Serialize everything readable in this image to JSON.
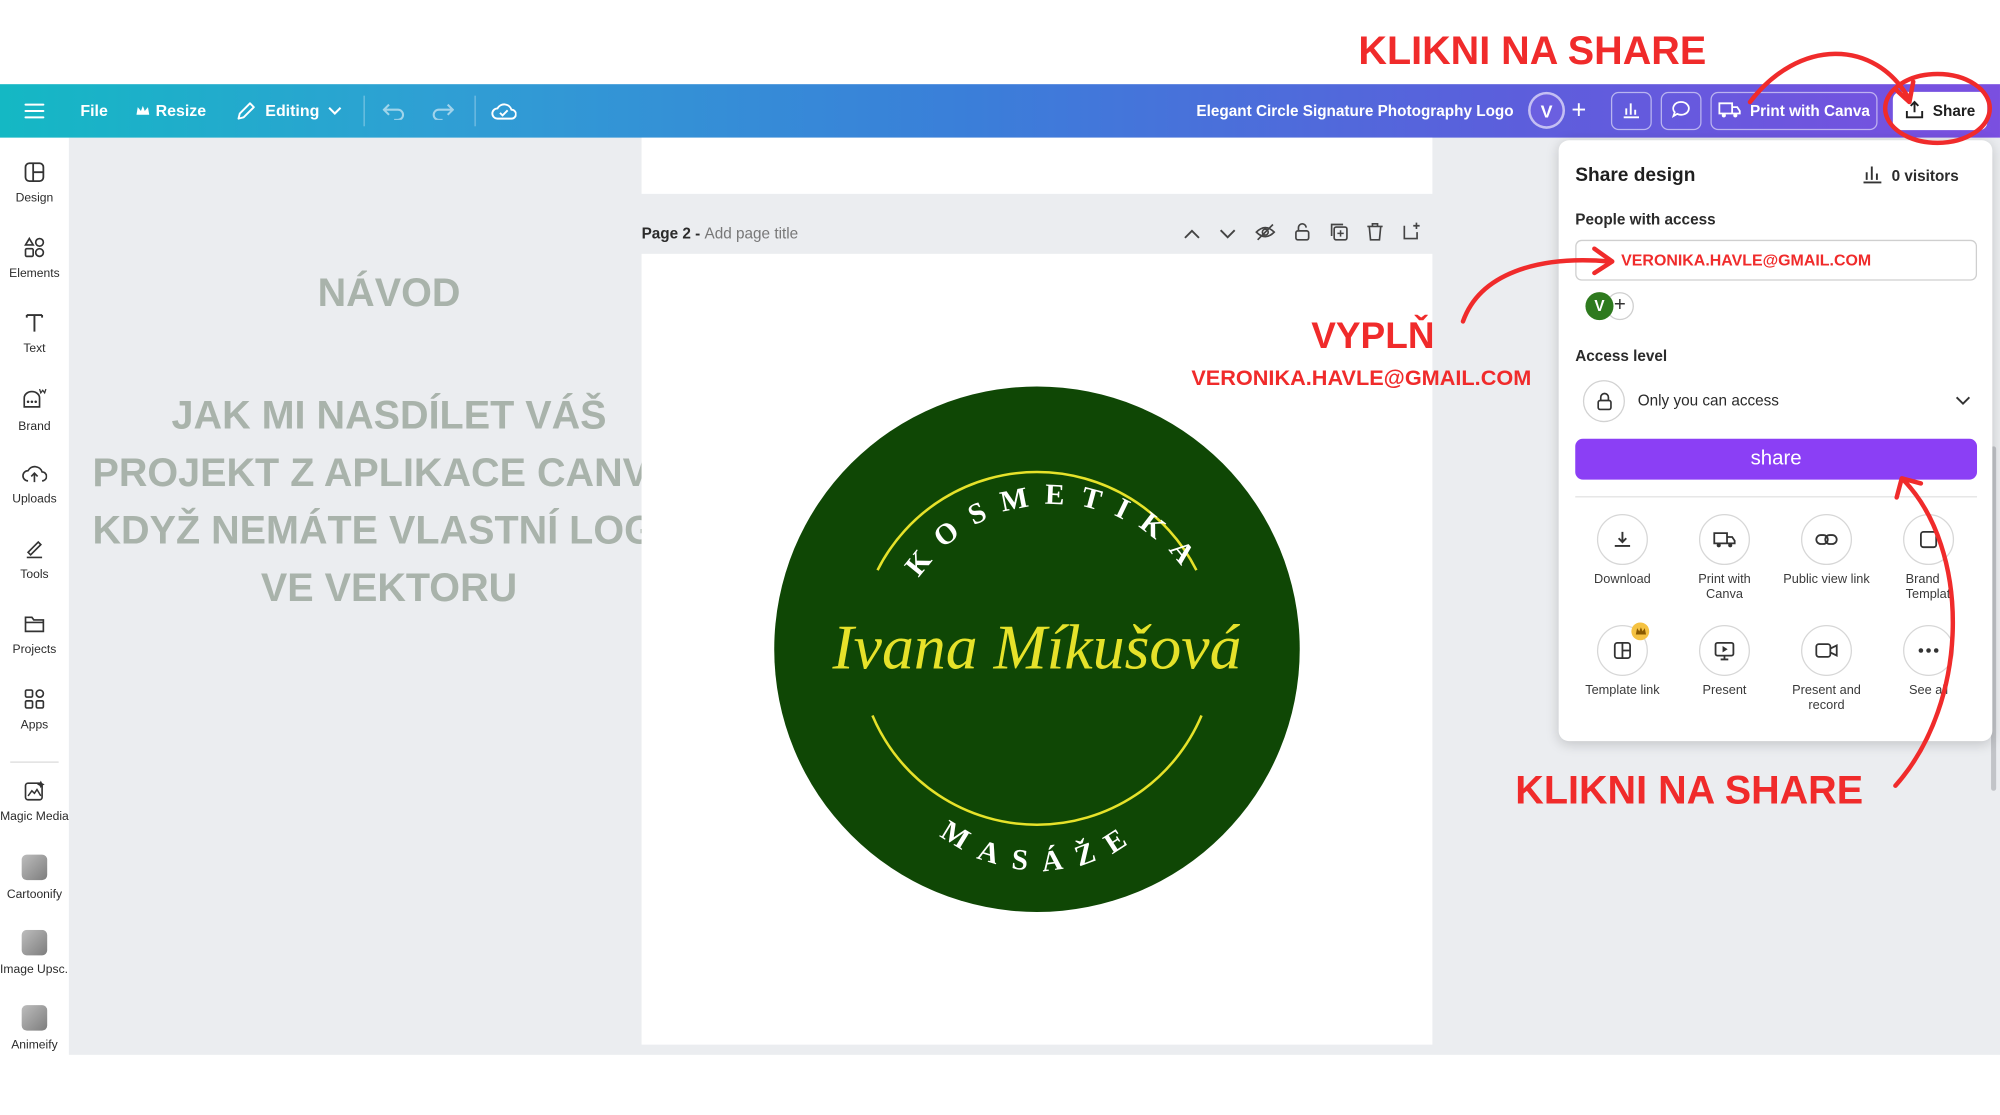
{
  "toolbar": {
    "file_label": "File",
    "resize_label": "Resize",
    "editing_label": "Editing",
    "design_title": "Elegant Circle Signature Photography Logo",
    "avatar_initial": "V",
    "print_label": "Print with Canva",
    "share_label": "Share"
  },
  "sidebar": {
    "items": [
      {
        "label": "Design",
        "icon": "layout-icon"
      },
      {
        "label": "Elements",
        "icon": "shapes-icon"
      },
      {
        "label": "Text",
        "icon": "text-icon"
      },
      {
        "label": "Brand",
        "icon": "brand-icon"
      },
      {
        "label": "Uploads",
        "icon": "cloud-upload-icon"
      },
      {
        "label": "Tools",
        "icon": "pen-icon"
      },
      {
        "label": "Projects",
        "icon": "folder-icon"
      },
      {
        "label": "Apps",
        "icon": "apps-icon"
      },
      {
        "label": "Magic Media",
        "icon": "magic-media-icon"
      },
      {
        "label": "Cartoonify",
        "icon": "cartoonify-thumbnail"
      },
      {
        "label": "Image Upsc...",
        "icon": "image-upscaler-thumbnail"
      },
      {
        "label": "Animeify",
        "icon": "animeify-thumbnail"
      }
    ]
  },
  "canvas": {
    "page_label": "Page 2 - ",
    "page_title_placeholder": "Add page title",
    "guide_heading": "NÁVOD",
    "guide_lines": [
      "JAK MI NASDÍLET VÁŠ",
      "PROJEKT Z APLIKACE CANVA,",
      "KDYŽ NEMÁTE VLASTNÍ LOGO",
      "VE VEKTORU"
    ],
    "logo": {
      "top_text": "KOSMETIKA",
      "name": "Ivana Míkušová",
      "bottom_text": "MASÁŽE",
      "circle_color": "#0f4705",
      "accent_color": "#e6e22a"
    }
  },
  "share_panel": {
    "title": "Share design",
    "visitors": "0 visitors",
    "people_label": "People with access",
    "email_value": "VERONIKA.HAVLE@GMAIL.COM",
    "owner_initial": "V",
    "access_label": "Access level",
    "access_value": "Only you can access",
    "share_button": "share",
    "options": [
      {
        "label": "Download",
        "icon": "download-icon"
      },
      {
        "label": "Print with Canva",
        "icon": "truck-icon"
      },
      {
        "label": "Public view link",
        "icon": "link-icon"
      },
      {
        "label": "Brand Templat",
        "icon": "brand-template-icon"
      },
      {
        "label": "Template link",
        "icon": "template-link-icon"
      },
      {
        "label": "Present",
        "icon": "present-icon"
      },
      {
        "label": "Present and record",
        "icon": "video-record-icon"
      },
      {
        "label": "See all",
        "icon": "more-icon"
      }
    ]
  },
  "annotations": {
    "top_instruction": "KLIKNI NA SHARE",
    "fill_instruction": "VYPLŇ",
    "fill_email": "VERONIKA.HAVLE@GMAIL.COM",
    "bottom_instruction": "KLIKNI NA SHARE",
    "color": "#f02b2b"
  }
}
